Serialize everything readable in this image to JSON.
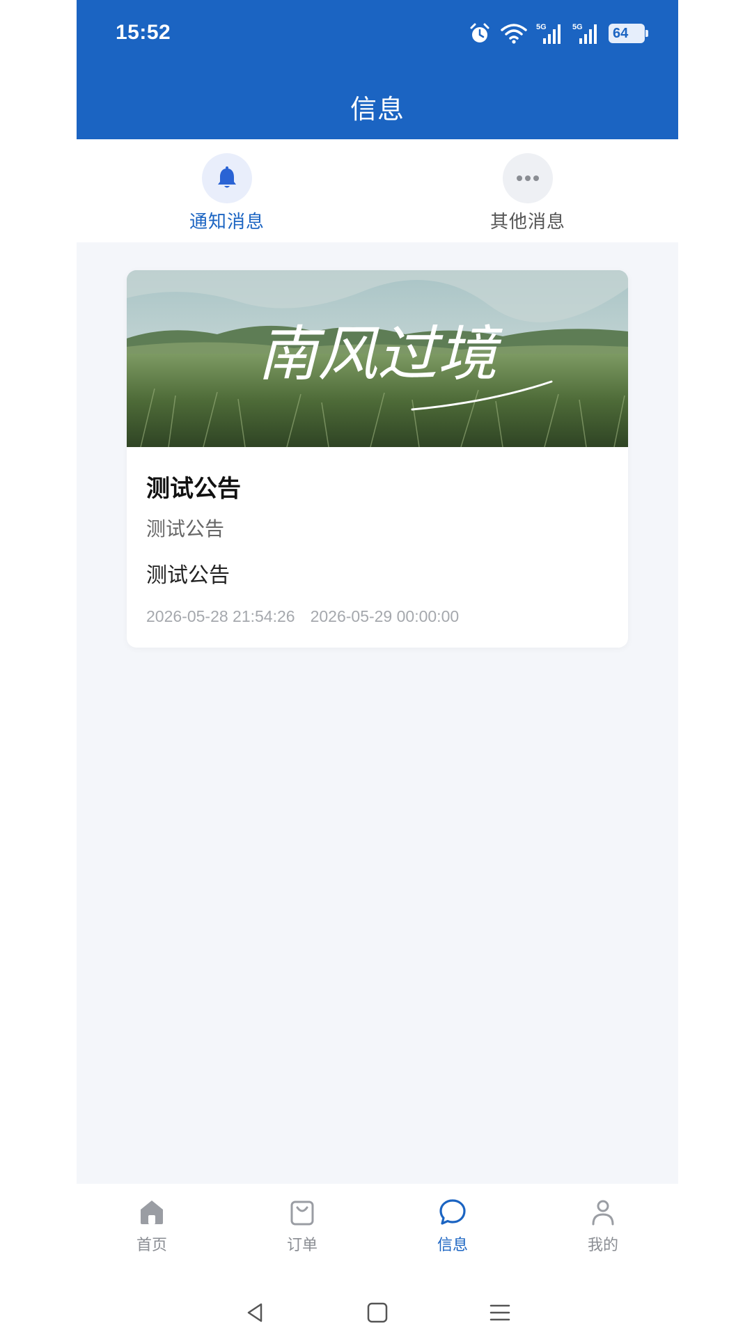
{
  "status_bar": {
    "time": "15:52",
    "battery": "64",
    "signal_1": "5G",
    "signal_2": "5G"
  },
  "header": {
    "title": "信息",
    "color": "#1b64c2"
  },
  "tabs": [
    {
      "label": "通知消息",
      "icon": "bell-icon",
      "active": true
    },
    {
      "label": "其他消息",
      "icon": "more-dots-icon",
      "active": false
    }
  ],
  "notices": [
    {
      "banner_text": "南风过境",
      "title": "测试公告",
      "subtitle": "测试公告",
      "content": "测试公告",
      "created_at": "2026-05-28 21:54:26",
      "expires_at": "2026-05-29 00:00:00"
    }
  ],
  "bottom_nav": [
    {
      "label": "首页",
      "icon": "home-icon",
      "active": false
    },
    {
      "label": "订单",
      "icon": "shopping-bag-icon",
      "active": false
    },
    {
      "label": "信息",
      "icon": "chat-bubble-icon",
      "active": true
    },
    {
      "label": "我的",
      "icon": "user-icon",
      "active": false
    }
  ],
  "system_nav": [
    "back-icon",
    "home-square-icon",
    "menu-icon"
  ]
}
